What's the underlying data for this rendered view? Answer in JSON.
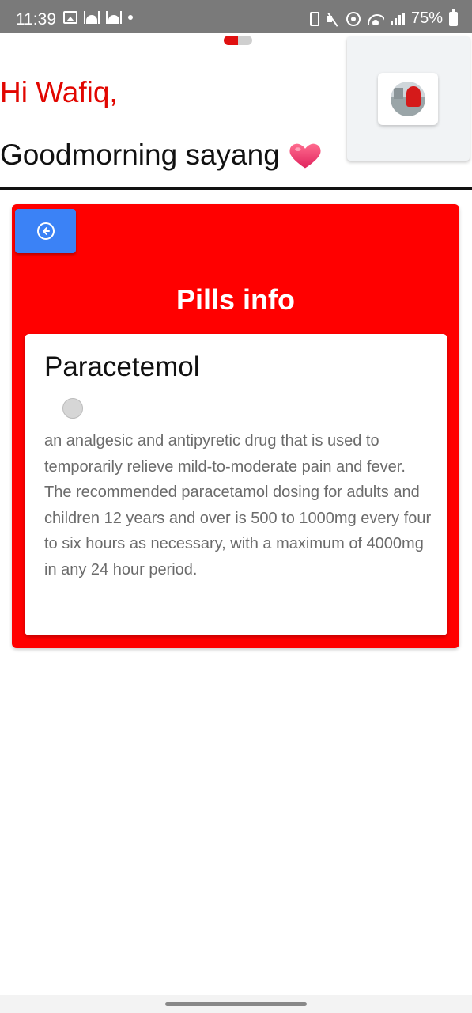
{
  "status_bar": {
    "time": "11:39",
    "battery": "75%",
    "icons": [
      "image-icon",
      "mosque-icon",
      "mosque-icon",
      "dot-icon",
      "vibrate-icon",
      "mute-icon",
      "hotspot-icon",
      "wifi-icon",
      "signal-icon",
      "battery-icon"
    ]
  },
  "header": {
    "greeting_name": "Hi Wafiq,",
    "greeting_message": "Goodmorning sayang",
    "heart_icon": "heart-icon",
    "heart_color": "#e83e6c"
  },
  "profile": {
    "avatar_icon": "avatar-photo"
  },
  "pill_card": {
    "back_icon": "back-arrow-icon",
    "title": "Pills info",
    "pill_name": "Paracetemol",
    "description": "an analgesic and antipyretic drug that is used to temporarily relieve mild-to-moderate pain and fever. The recommended paracetamol dosing for adults and children 12 years and over is 500 to 1000mg every four to six hours as necessary, with a maximum of 4000mg in any 24 hour period."
  },
  "colors": {
    "accent_red": "#ff0000",
    "greeting_red": "#e10600",
    "button_blue": "#3b82f6"
  }
}
